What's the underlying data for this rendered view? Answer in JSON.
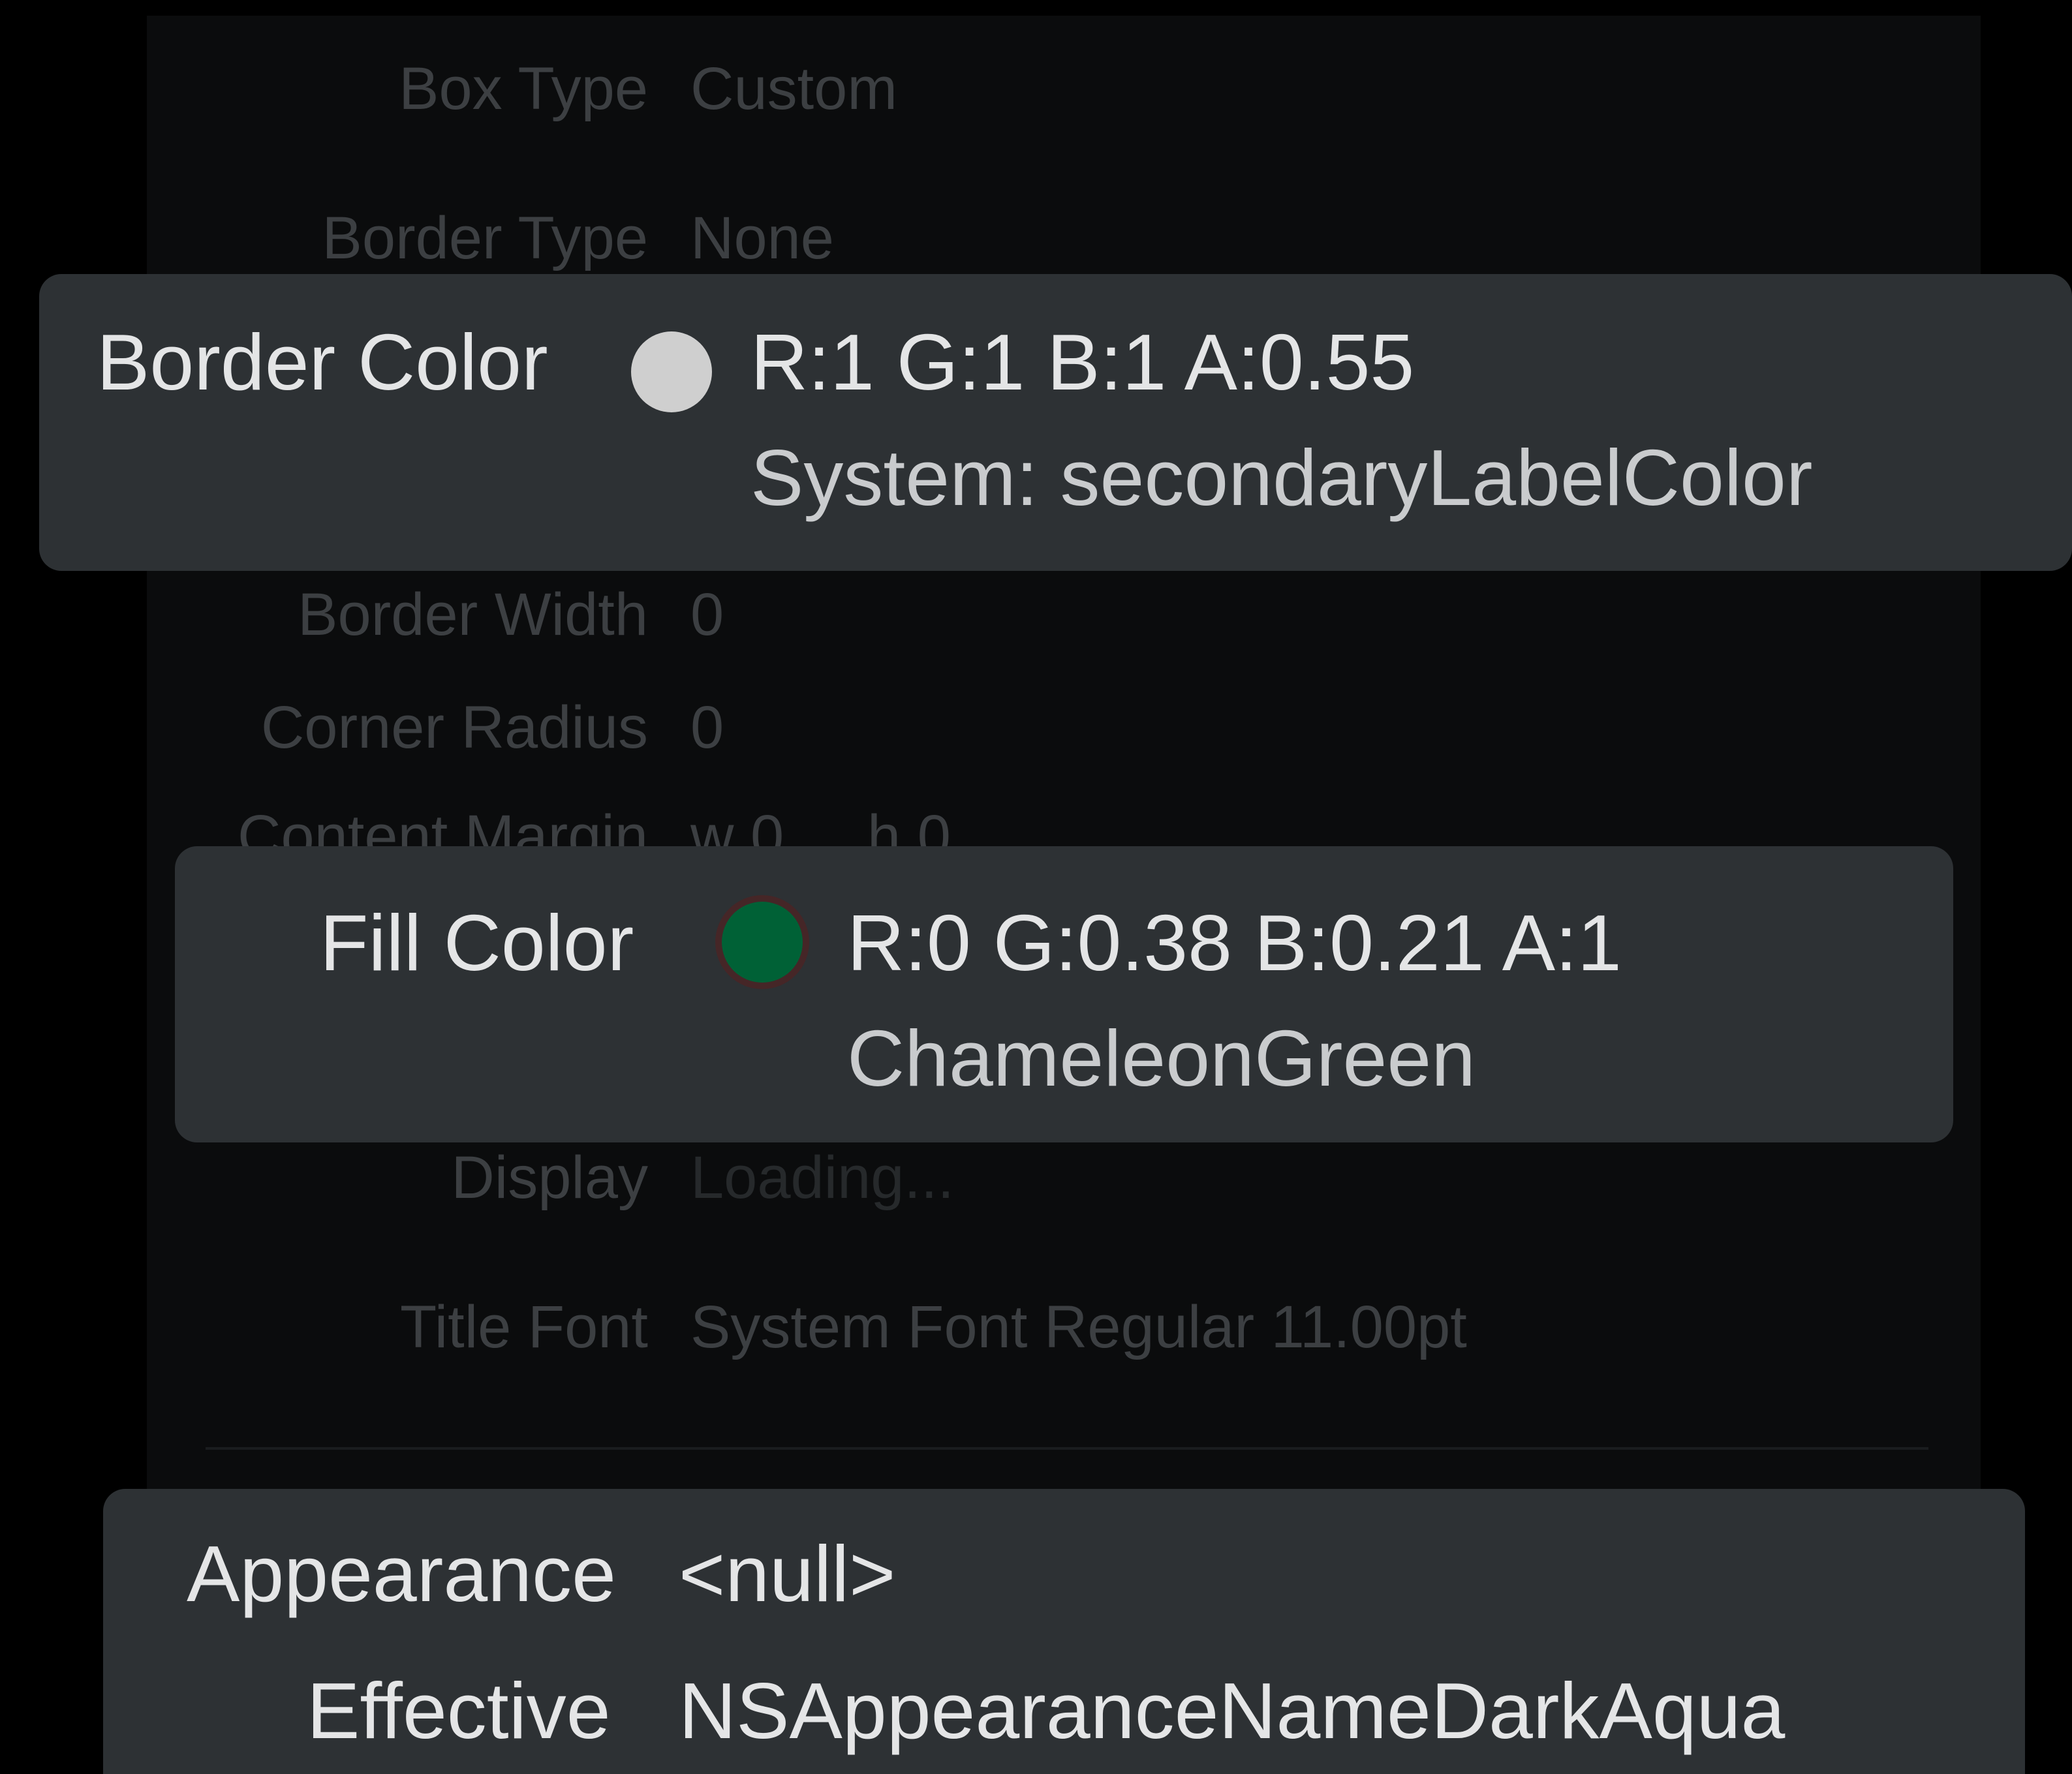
{
  "inspector": {
    "rows": [
      {
        "label": "Box Type",
        "value": "Custom"
      },
      {
        "label": "Border Type",
        "value": "None"
      },
      {
        "label": "Border Width",
        "value": "0"
      },
      {
        "label": "Corner Radius",
        "value": "0"
      },
      {
        "label": "Content Margin",
        "value": "w 0     h 0"
      },
      {
        "label": "Display",
        "value": "Loading..."
      },
      {
        "label": "Title Font",
        "value": "System Font Regular 11.00pt"
      }
    ]
  },
  "border_color": {
    "label": "Border Color",
    "rgba": "R:1 G:1 B:1 A:0.55",
    "name": "System: secondaryLabelColor",
    "swatch_color": "#cfcfcf"
  },
  "fill_color": {
    "label": "Fill Color",
    "rgba": "R:0 G:0.38 B:0.21 A:1",
    "name": "ChameleonGreen",
    "swatch_color": "#006136"
  },
  "appearance": {
    "label": "Appearance",
    "value": "<null>",
    "effective_label": "Effective",
    "effective_value": "NSAppearanceNameDarkAqua"
  },
  "colors": {
    "callout_bg": "#2d3134",
    "page_bg": "#000000",
    "panel_bg": "#0b0c0d",
    "dim_text": "#3c3f42",
    "bright_text": "#e4e5e6"
  }
}
